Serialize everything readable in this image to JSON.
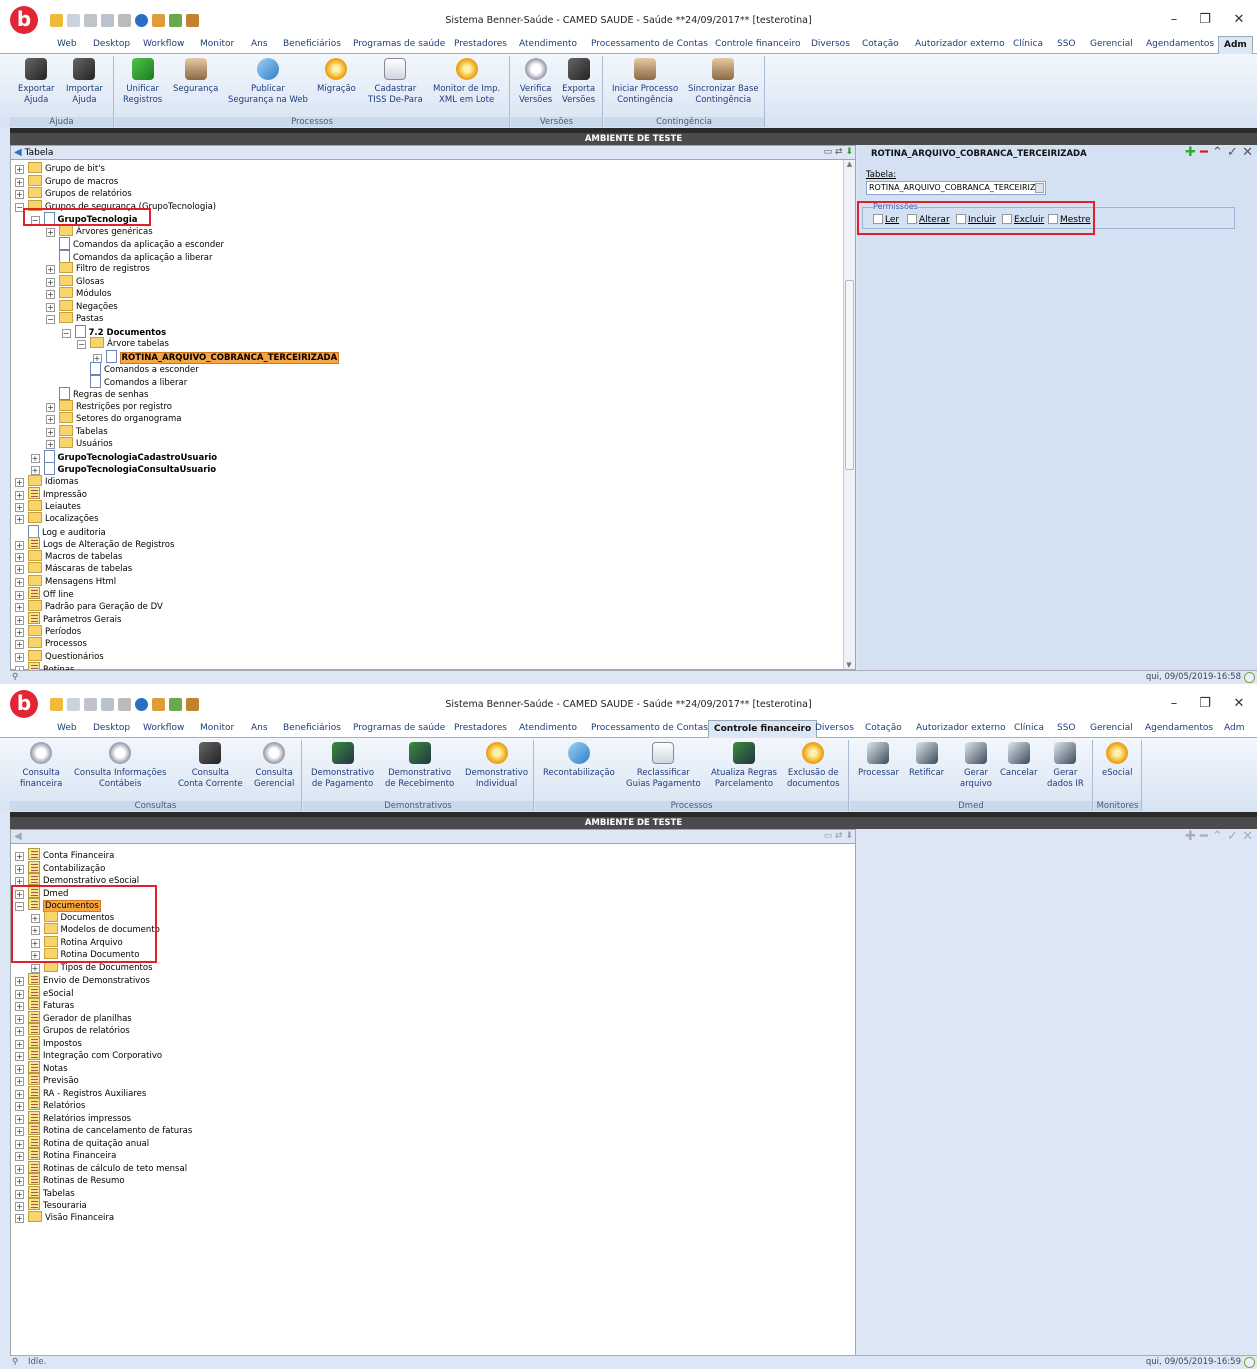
{
  "window1": {
    "title": "Sistema Benner-Saúde - CAMED SAUDE - Saúde **24/09/2017** [testerotina]",
    "tabs": [
      "Web",
      "Desktop",
      "Workflow",
      "Monitor",
      "Ans",
      "Beneficiários",
      "Programas de saúde",
      "Prestadores",
      "Atendimento",
      "Processamento de Contas",
      "Controle financeiro",
      "Diversos",
      "Cotação",
      "Autorizador externo",
      "Clínica",
      "SSO",
      "Gerencial",
      "Agendamentos",
      "Adm"
    ],
    "active_tab": "Adm",
    "ribbon_groups": [
      {
        "label": "Ajuda",
        "buttons": [
          [
            "Exportar",
            "Ajuda"
          ],
          [
            "Importar",
            "Ajuda"
          ]
        ]
      },
      {
        "label": "Processos",
        "buttons": [
          [
            "Unificar",
            "Registros"
          ],
          [
            "Segurança",
            ""
          ],
          [
            "Publicar",
            "Segurança na Web"
          ],
          [
            "Migração",
            ""
          ],
          [
            "Cadastrar",
            "TISS De-Para"
          ],
          [
            "Monitor de Imp.",
            "XML em Lote"
          ]
        ]
      },
      {
        "label": "Versões",
        "buttons": [
          [
            "Verifica",
            "Versões"
          ],
          [
            "Exporta",
            "Versões"
          ]
        ]
      },
      {
        "label": "Contingência",
        "buttons": [
          [
            "Iniciar Processo",
            "Contingência"
          ],
          [
            "Sincronizar Base",
            "Contingência"
          ]
        ]
      }
    ],
    "ambient": "AMBIENTE DE TESTE",
    "left_header": "Tabela",
    "tree": [
      {
        "label": "Grupo de bit's",
        "indent": 0,
        "icon": "folder"
      },
      {
        "label": "Grupo de macros",
        "indent": 0,
        "icon": "folder"
      },
      {
        "label": "Grupos de relatórios",
        "indent": 0,
        "icon": "folder"
      },
      {
        "label": "Grupos de segurança (GrupoTecnologia)",
        "indent": 0,
        "icon": "folder"
      },
      {
        "label": "GrupoTecnologia",
        "indent": 1,
        "icon": "doc",
        "bold": true
      },
      {
        "label": "Árvores genéricas",
        "indent": 2,
        "icon": "folder"
      },
      {
        "label": "Comandos da aplicação a esconder",
        "indent": 2,
        "icon": "doc",
        "leaf": true
      },
      {
        "label": "Comandos da aplicação a liberar",
        "indent": 2,
        "icon": "doc",
        "leaf": true
      },
      {
        "label": "Filtro de registros",
        "indent": 2,
        "icon": "folder"
      },
      {
        "label": "Glosas",
        "indent": 2,
        "icon": "folder"
      },
      {
        "label": "Módulos",
        "indent": 2,
        "icon": "folder"
      },
      {
        "label": "Negações",
        "indent": 2,
        "icon": "folder"
      },
      {
        "label": "Pastas",
        "indent": 2,
        "icon": "folder"
      },
      {
        "label": "7.2 Documentos",
        "indent": 3,
        "icon": "doc",
        "bold": true
      },
      {
        "label": "Árvore tabelas",
        "indent": 4,
        "icon": "folder"
      },
      {
        "label": "ROTINA_ARQUIVO_COBRANCA_TERCEIRIZADA",
        "indent": 5,
        "icon": "doc",
        "bold": true,
        "highlight": true
      },
      {
        "label": "Comandos a esconder",
        "indent": 4,
        "icon": "doc",
        "leaf": true
      },
      {
        "label": "Comandos a liberar",
        "indent": 4,
        "icon": "doc",
        "leaf": true
      },
      {
        "label": "Regras de senhas",
        "indent": 2,
        "icon": "doc",
        "leaf": true
      },
      {
        "label": "Restrições por registro",
        "indent": 2,
        "icon": "folder"
      },
      {
        "label": "Setores do organograma",
        "indent": 2,
        "icon": "folder"
      },
      {
        "label": "Tabelas",
        "indent": 2,
        "icon": "folder"
      },
      {
        "label": "Usuários",
        "indent": 2,
        "icon": "folder"
      },
      {
        "label": "GrupoTecnologiaCadastroUsuario",
        "indent": 1,
        "icon": "doc",
        "bold": true
      },
      {
        "label": "GrupoTecnologiaConsultaUsuario",
        "indent": 1,
        "icon": "doc",
        "bold": true
      },
      {
        "label": "Idiomas",
        "indent": 0,
        "icon": "folder"
      },
      {
        "label": "Impressão",
        "indent": 0,
        "icon": "book"
      },
      {
        "label": "Leiautes",
        "indent": 0,
        "icon": "folder"
      },
      {
        "label": "Localizações",
        "indent": 0,
        "icon": "folder"
      },
      {
        "label": "Log e auditoria",
        "indent": 0,
        "icon": "doc",
        "leaf": true
      },
      {
        "label": "Logs de Alteração de Registros",
        "indent": 0,
        "icon": "book"
      },
      {
        "label": "Macros de tabelas",
        "indent": 0,
        "icon": "folder"
      },
      {
        "label": "Máscaras de tabelas",
        "indent": 0,
        "icon": "folder"
      },
      {
        "label": "Mensagens Html",
        "indent": 0,
        "icon": "folder"
      },
      {
        "label": "Off line",
        "indent": 0,
        "icon": "book"
      },
      {
        "label": "Padrão para Geração de DV",
        "indent": 0,
        "icon": "folder"
      },
      {
        "label": "Parâmetros Gerais",
        "indent": 0,
        "icon": "book"
      },
      {
        "label": "Períodos",
        "indent": 0,
        "icon": "folder"
      },
      {
        "label": "Processos",
        "indent": 0,
        "icon": "folder"
      },
      {
        "label": "Questionários",
        "indent": 0,
        "icon": "folder"
      },
      {
        "label": "Rotinas",
        "indent": 0,
        "icon": "book"
      }
    ],
    "right_title": "ROTINA_ARQUIVO_COBRANCA_TERCEIRIZADA",
    "field_label": "Tabela:",
    "field_value": "ROTINA_ARQUIVO_COBRANCA_TERCEIRIZ",
    "perm_legend": "Permissões",
    "permissions": [
      "Ler",
      "Alterar",
      "Incluir",
      "Excluir",
      "Mestre"
    ],
    "status_time": "qui, 09/05/2019-16:58"
  },
  "window2": {
    "title": "Sistema Benner-Saúde - CAMED SAUDE - Saúde **24/09/2017** [testerotina]",
    "tabs": [
      "Web",
      "Desktop",
      "Workflow",
      "Monitor",
      "Ans",
      "Beneficiários",
      "Programas de saúde",
      "Prestadores",
      "Atendimento",
      "Processamento de Contas",
      "Controle financeiro",
      "Diversos",
      "Cotação",
      "Autorizador externo",
      "Clínica",
      "SSO",
      "Gerencial",
      "Agendamentos",
      "Adm"
    ],
    "active_tab": "Controle financeiro",
    "ribbon_groups": [
      {
        "label": "Consultas",
        "buttons": [
          [
            "Consulta",
            "financeira"
          ],
          [
            "Consulta Informações",
            "Contábeis"
          ],
          [
            "Consulta",
            "Conta Corrente"
          ],
          [
            "Consulta",
            "Gerencial"
          ]
        ]
      },
      {
        "label": "Demonstrativos",
        "buttons": [
          [
            "Demonstrativo",
            "de Pagamento"
          ],
          [
            "Demonstrativo",
            "de Recebimento"
          ],
          [
            "Demonstrativo",
            "Individual"
          ]
        ]
      },
      {
        "label": "Processos",
        "buttons": [
          [
            "Recontabilização",
            ""
          ],
          [
            "Reclassificar",
            "Guias Pagamento"
          ],
          [
            "Atualiza Regras",
            "Parcelamento"
          ],
          [
            "Exclusão de",
            "documentos"
          ]
        ]
      },
      {
        "label": "Dmed",
        "buttons": [
          [
            "Processar",
            ""
          ],
          [
            "Retificar",
            ""
          ],
          [
            "Gerar",
            "arquivo"
          ],
          [
            "Cancelar",
            ""
          ],
          [
            "Gerar",
            "dados IR"
          ]
        ]
      },
      {
        "label": "Monitores",
        "buttons": [
          [
            "eSocial",
            ""
          ]
        ]
      }
    ],
    "ambient": "AMBIENTE DE TESTE",
    "tree": [
      {
        "label": "Conta Financeira",
        "indent": 0,
        "icon": "book"
      },
      {
        "label": "Contabilização",
        "indent": 0,
        "icon": "book"
      },
      {
        "label": "Demonstrativo eSocial",
        "indent": 0,
        "icon": "book"
      },
      {
        "label": "Dmed",
        "indent": 0,
        "icon": "book"
      },
      {
        "label": "Documentos",
        "indent": 0,
        "icon": "book",
        "highlight": true,
        "open": true
      },
      {
        "label": "Documentos",
        "indent": 1,
        "icon": "folder"
      },
      {
        "label": "Modelos de documento",
        "indent": 1,
        "icon": "folder"
      },
      {
        "label": "Rotina Arquivo",
        "indent": 1,
        "icon": "folder"
      },
      {
        "label": "Rotina Documento",
        "indent": 1,
        "icon": "folder"
      },
      {
        "label": "Tipos de Documentos",
        "indent": 1,
        "icon": "folder"
      },
      {
        "label": "Envio de Demonstrativos",
        "indent": 0,
        "icon": "book"
      },
      {
        "label": "eSocial",
        "indent": 0,
        "icon": "book"
      },
      {
        "label": "Faturas",
        "indent": 0,
        "icon": "book"
      },
      {
        "label": "Gerador de planilhas",
        "indent": 0,
        "icon": "book"
      },
      {
        "label": "Grupos de relatórios",
        "indent": 0,
        "icon": "book"
      },
      {
        "label": "Impostos",
        "indent": 0,
        "icon": "book"
      },
      {
        "label": "Integração com Corporativo",
        "indent": 0,
        "icon": "book"
      },
      {
        "label": "Notas",
        "indent": 0,
        "icon": "book"
      },
      {
        "label": "Previsão",
        "indent": 0,
        "icon": "book"
      },
      {
        "label": "RA - Registros Auxiliares",
        "indent": 0,
        "icon": "book"
      },
      {
        "label": "Relatórios",
        "indent": 0,
        "icon": "book"
      },
      {
        "label": "Relatórios impressos",
        "indent": 0,
        "icon": "book"
      },
      {
        "label": "Rotina de cancelamento de faturas",
        "indent": 0,
        "icon": "book"
      },
      {
        "label": "Rotina de quitação anual",
        "indent": 0,
        "icon": "book"
      },
      {
        "label": "Rotina Financeira",
        "indent": 0,
        "icon": "book"
      },
      {
        "label": "Rotinas de cálculo de teto mensal",
        "indent": 0,
        "icon": "book"
      },
      {
        "label": "Rotinas de Resumo",
        "indent": 0,
        "icon": "book"
      },
      {
        "label": "Tabelas",
        "indent": 0,
        "icon": "book"
      },
      {
        "label": "Tesouraria",
        "indent": 0,
        "icon": "book"
      },
      {
        "label": "Visão Financeira",
        "indent": 0,
        "icon": "folder"
      }
    ],
    "status_left": "Idle.",
    "status_time": "qui, 09/05/2019-16:59"
  }
}
